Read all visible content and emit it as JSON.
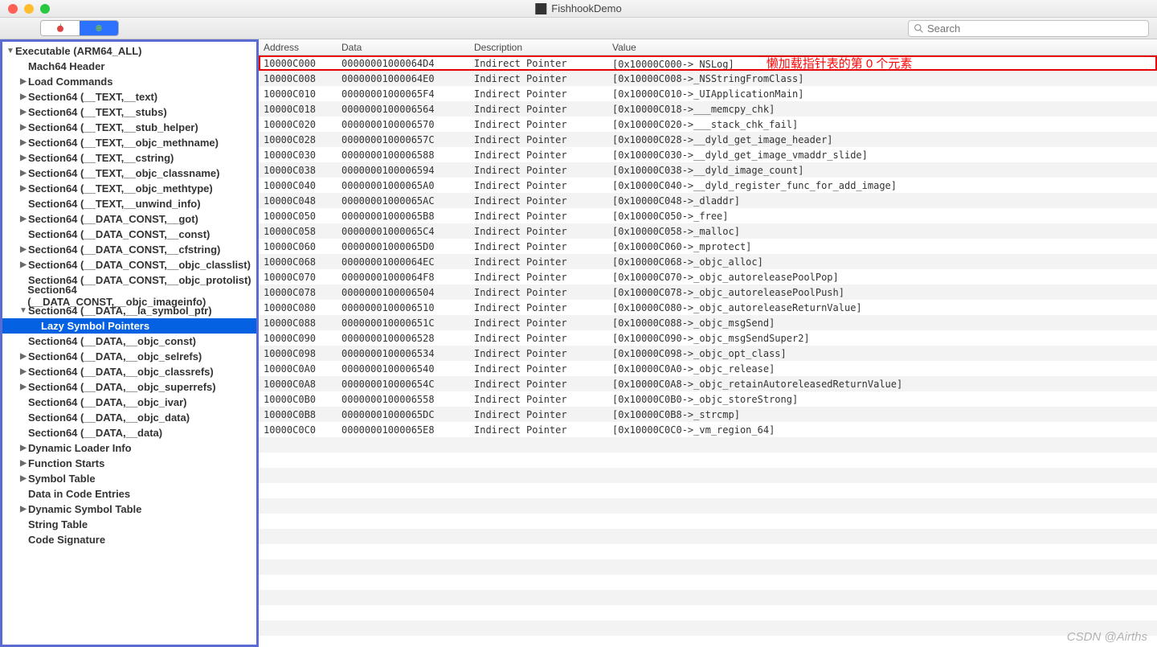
{
  "window": {
    "title": "FishhookDemo"
  },
  "search": {
    "placeholder": "Search"
  },
  "annotation": "懒加载指针表的第 0 个元素",
  "watermark": "CSDN @Airths",
  "tree": {
    "root": "Executable  (ARM64_ALL)",
    "items": [
      {
        "label": "Mach64 Header",
        "indent": 1,
        "arrow": "none"
      },
      {
        "label": "Load Commands",
        "indent": 1,
        "arrow": "closed"
      },
      {
        "label": "Section64 (__TEXT,__text)",
        "indent": 1,
        "arrow": "closed"
      },
      {
        "label": "Section64 (__TEXT,__stubs)",
        "indent": 1,
        "arrow": "closed"
      },
      {
        "label": "Section64 (__TEXT,__stub_helper)",
        "indent": 1,
        "arrow": "closed"
      },
      {
        "label": "Section64 (__TEXT,__objc_methname)",
        "indent": 1,
        "arrow": "closed"
      },
      {
        "label": "Section64 (__TEXT,__cstring)",
        "indent": 1,
        "arrow": "closed"
      },
      {
        "label": "Section64 (__TEXT,__objc_classname)",
        "indent": 1,
        "arrow": "closed"
      },
      {
        "label": "Section64 (__TEXT,__objc_methtype)",
        "indent": 1,
        "arrow": "closed"
      },
      {
        "label": "Section64 (__TEXT,__unwind_info)",
        "indent": 1,
        "arrow": "none"
      },
      {
        "label": "Section64 (__DATA_CONST,__got)",
        "indent": 1,
        "arrow": "closed"
      },
      {
        "label": "Section64 (__DATA_CONST,__const)",
        "indent": 1,
        "arrow": "none"
      },
      {
        "label": "Section64 (__DATA_CONST,__cfstring)",
        "indent": 1,
        "arrow": "closed"
      },
      {
        "label": "Section64 (__DATA_CONST,__objc_classlist)",
        "indent": 1,
        "arrow": "closed"
      },
      {
        "label": "Section64 (__DATA_CONST,__objc_protolist)",
        "indent": 1,
        "arrow": "none"
      },
      {
        "label": "Section64 (__DATA_CONST,__objc_imageinfo)",
        "indent": 1,
        "arrow": "none"
      },
      {
        "label": "Section64 (__DATA,__la_symbol_ptr)",
        "indent": 1,
        "arrow": "open"
      },
      {
        "label": "Lazy Symbol Pointers",
        "indent": 2,
        "arrow": "none",
        "selected": true
      },
      {
        "label": "Section64 (__DATA,__objc_const)",
        "indent": 1,
        "arrow": "none"
      },
      {
        "label": "Section64 (__DATA,__objc_selrefs)",
        "indent": 1,
        "arrow": "closed"
      },
      {
        "label": "Section64 (__DATA,__objc_classrefs)",
        "indent": 1,
        "arrow": "closed"
      },
      {
        "label": "Section64 (__DATA,__objc_superrefs)",
        "indent": 1,
        "arrow": "closed"
      },
      {
        "label": "Section64 (__DATA,__objc_ivar)",
        "indent": 1,
        "arrow": "none"
      },
      {
        "label": "Section64 (__DATA,__objc_data)",
        "indent": 1,
        "arrow": "none"
      },
      {
        "label": "Section64 (__DATA,__data)",
        "indent": 1,
        "arrow": "none"
      },
      {
        "label": "Dynamic Loader Info",
        "indent": 1,
        "arrow": "closed"
      },
      {
        "label": "Function Starts",
        "indent": 1,
        "arrow": "closed"
      },
      {
        "label": "Symbol Table",
        "indent": 1,
        "arrow": "closed"
      },
      {
        "label": "Data in Code Entries",
        "indent": 1,
        "arrow": "none"
      },
      {
        "label": "Dynamic Symbol Table",
        "indent": 1,
        "arrow": "closed"
      },
      {
        "label": "String Table",
        "indent": 1,
        "arrow": "none"
      },
      {
        "label": "Code Signature",
        "indent": 1,
        "arrow": "none"
      }
    ]
  },
  "table": {
    "headers": {
      "address": "Address",
      "data": "Data",
      "description": "Description",
      "value": "Value"
    },
    "rows": [
      {
        "addr": "10000C000",
        "data": "00000001000064D4",
        "desc": "Indirect Pointer",
        "val": "[0x10000C000->_NSLog]",
        "hl": true
      },
      {
        "addr": "10000C008",
        "data": "00000001000064E0",
        "desc": "Indirect Pointer",
        "val": "[0x10000C008->_NSStringFromClass]"
      },
      {
        "addr": "10000C010",
        "data": "00000001000065F4",
        "desc": "Indirect Pointer",
        "val": "[0x10000C010->_UIApplicationMain]"
      },
      {
        "addr": "10000C018",
        "data": "0000000100006564",
        "desc": "Indirect Pointer",
        "val": "[0x10000C018->___memcpy_chk]"
      },
      {
        "addr": "10000C020",
        "data": "0000000100006570",
        "desc": "Indirect Pointer",
        "val": "[0x10000C020->___stack_chk_fail]"
      },
      {
        "addr": "10000C028",
        "data": "000000010000657C",
        "desc": "Indirect Pointer",
        "val": "[0x10000C028->__dyld_get_image_header]"
      },
      {
        "addr": "10000C030",
        "data": "0000000100006588",
        "desc": "Indirect Pointer",
        "val": "[0x10000C030->__dyld_get_image_vmaddr_slide]"
      },
      {
        "addr": "10000C038",
        "data": "0000000100006594",
        "desc": "Indirect Pointer",
        "val": "[0x10000C038->__dyld_image_count]"
      },
      {
        "addr": "10000C040",
        "data": "00000001000065A0",
        "desc": "Indirect Pointer",
        "val": "[0x10000C040->__dyld_register_func_for_add_image]"
      },
      {
        "addr": "10000C048",
        "data": "00000001000065AC",
        "desc": "Indirect Pointer",
        "val": "[0x10000C048->_dladdr]"
      },
      {
        "addr": "10000C050",
        "data": "00000001000065B8",
        "desc": "Indirect Pointer",
        "val": "[0x10000C050->_free]"
      },
      {
        "addr": "10000C058",
        "data": "00000001000065C4",
        "desc": "Indirect Pointer",
        "val": "[0x10000C058->_malloc]"
      },
      {
        "addr": "10000C060",
        "data": "00000001000065D0",
        "desc": "Indirect Pointer",
        "val": "[0x10000C060->_mprotect]"
      },
      {
        "addr": "10000C068",
        "data": "00000001000064EC",
        "desc": "Indirect Pointer",
        "val": "[0x10000C068->_objc_alloc]"
      },
      {
        "addr": "10000C070",
        "data": "00000001000064F8",
        "desc": "Indirect Pointer",
        "val": "[0x10000C070->_objc_autoreleasePoolPop]"
      },
      {
        "addr": "10000C078",
        "data": "0000000100006504",
        "desc": "Indirect Pointer",
        "val": "[0x10000C078->_objc_autoreleasePoolPush]"
      },
      {
        "addr": "10000C080",
        "data": "0000000100006510",
        "desc": "Indirect Pointer",
        "val": "[0x10000C080->_objc_autoreleaseReturnValue]"
      },
      {
        "addr": "10000C088",
        "data": "000000010000651C",
        "desc": "Indirect Pointer",
        "val": "[0x10000C088->_objc_msgSend]"
      },
      {
        "addr": "10000C090",
        "data": "0000000100006528",
        "desc": "Indirect Pointer",
        "val": "[0x10000C090->_objc_msgSendSuper2]"
      },
      {
        "addr": "10000C098",
        "data": "0000000100006534",
        "desc": "Indirect Pointer",
        "val": "[0x10000C098->_objc_opt_class]"
      },
      {
        "addr": "10000C0A0",
        "data": "0000000100006540",
        "desc": "Indirect Pointer",
        "val": "[0x10000C0A0->_objc_release]"
      },
      {
        "addr": "10000C0A8",
        "data": "000000010000654C",
        "desc": "Indirect Pointer",
        "val": "[0x10000C0A8->_objc_retainAutoreleasedReturnValue]"
      },
      {
        "addr": "10000C0B0",
        "data": "0000000100006558",
        "desc": "Indirect Pointer",
        "val": "[0x10000C0B0->_objc_storeStrong]"
      },
      {
        "addr": "10000C0B8",
        "data": "00000001000065DC",
        "desc": "Indirect Pointer",
        "val": "[0x10000C0B8->_strcmp]"
      },
      {
        "addr": "10000C0C0",
        "data": "00000001000065E8",
        "desc": "Indirect Pointer",
        "val": "[0x10000C0C0->_vm_region_64]"
      }
    ]
  }
}
